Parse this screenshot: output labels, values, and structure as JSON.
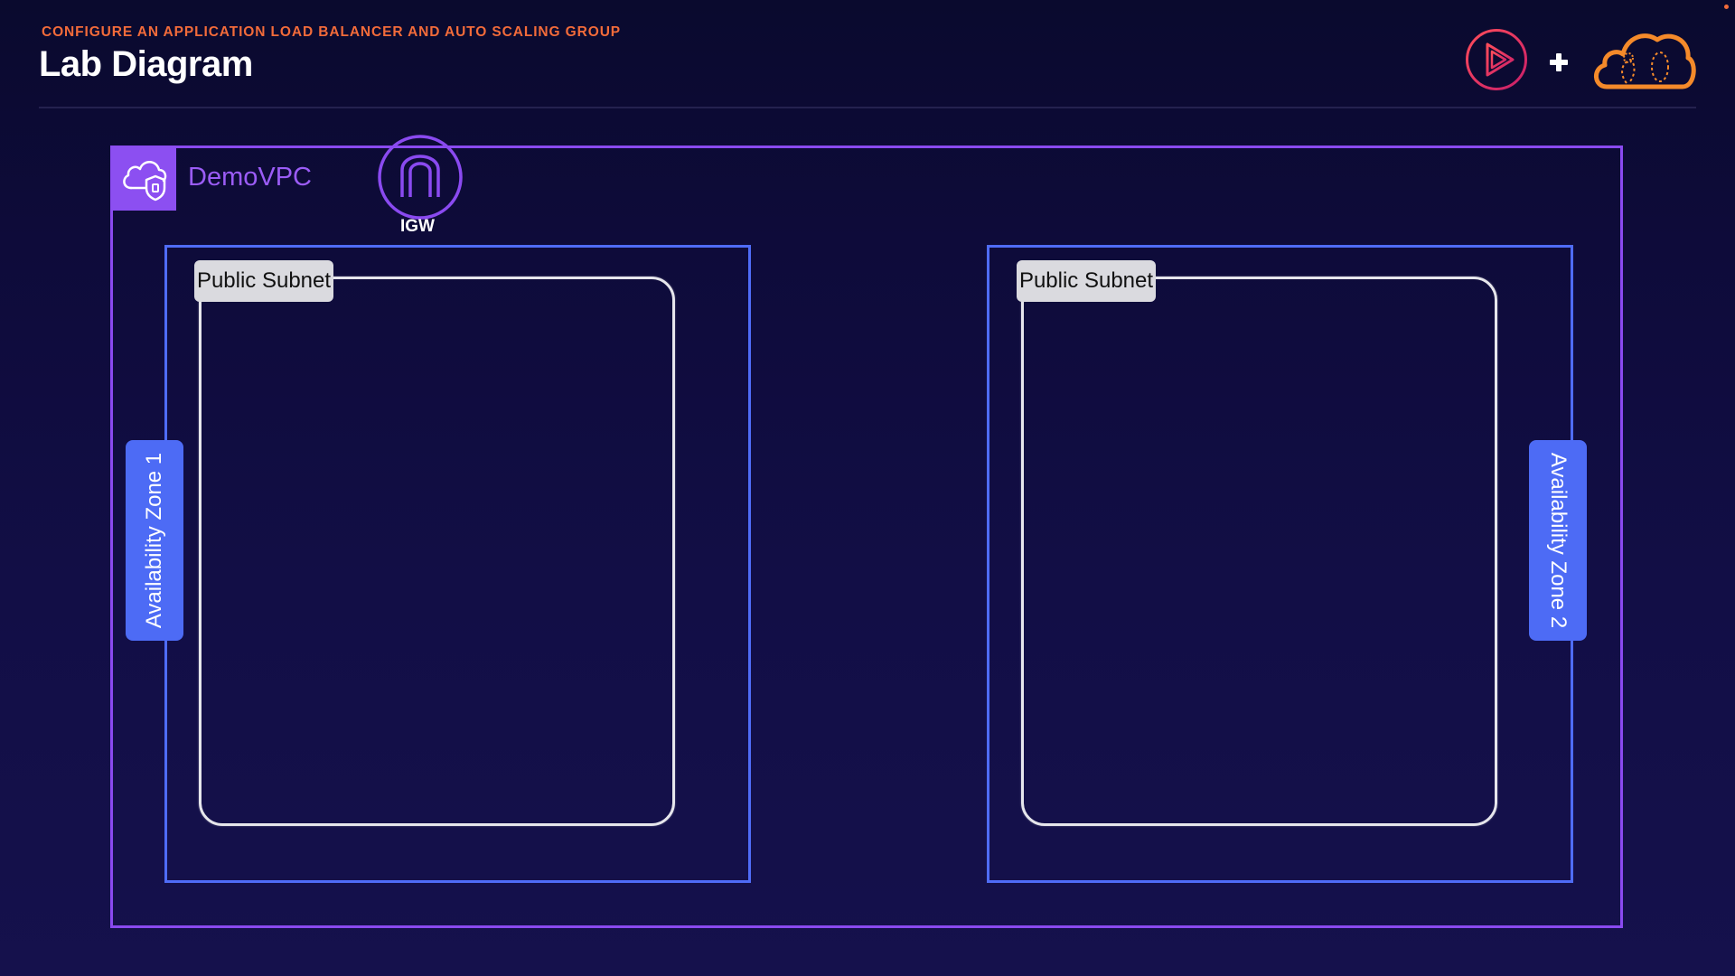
{
  "header": {
    "subtitle": "CONFIGURE AN APPLICATION LOAD BALANCER AND AUTO SCALING GROUP",
    "title": "Lab Diagram"
  },
  "logos": {
    "left": "pluralsight-play-icon",
    "separator": "+",
    "right": "acloudguru-cloud-icon"
  },
  "diagram": {
    "vpc": {
      "label": "DemoVPC",
      "icon": "vpc-cloud-shield-icon"
    },
    "igw": {
      "label": "IGW",
      "icon": "internet-gateway-icon"
    },
    "availability_zones": [
      {
        "label": "Availability Zone 1",
        "subnet_label": "Public Subnet"
      },
      {
        "label": "Availability Zone 2",
        "subnet_label": "Public Subnet"
      }
    ]
  },
  "colors": {
    "background": "#0e0b3a",
    "accent_orange": "#f26b3a",
    "vpc_purple": "#8a4af0",
    "az_blue": "#4f6cf7",
    "subnet_border": "#e6e6ec",
    "brand_red": "#e0245e"
  }
}
